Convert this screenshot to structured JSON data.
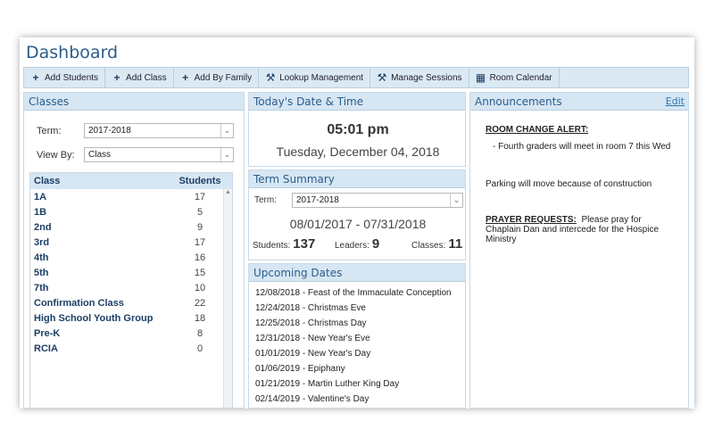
{
  "title": "Dashboard",
  "toolbar": [
    {
      "icon": "plus-icon",
      "glyph": "+",
      "label": "Add Students"
    },
    {
      "icon": "plus-icon",
      "glyph": "+",
      "label": "Add Class"
    },
    {
      "icon": "plus-icon",
      "glyph": "+",
      "label": "Add By Family"
    },
    {
      "icon": "wrench-icon",
      "glyph": "⚒",
      "label": "Lookup Management"
    },
    {
      "icon": "wrench-icon",
      "glyph": "⚒",
      "label": "Manage Sessions"
    },
    {
      "icon": "calendar-icon",
      "glyph": "▦",
      "label": "Room Calendar"
    }
  ],
  "classes": {
    "header": "Classes",
    "term_label": "Term:",
    "term_value": "2017-2018",
    "viewby_label": "View By:",
    "viewby_value": "Class",
    "col_class": "Class",
    "col_students": "Students",
    "rows": [
      {
        "name": "1A",
        "count": "17"
      },
      {
        "name": "1B",
        "count": "5"
      },
      {
        "name": "2nd",
        "count": "9"
      },
      {
        "name": "3rd",
        "count": "17"
      },
      {
        "name": "4th",
        "count": "16"
      },
      {
        "name": "5th",
        "count": "15"
      },
      {
        "name": "7th",
        "count": "10"
      },
      {
        "name": "Confirmation Class",
        "count": "22"
      },
      {
        "name": "High School Youth Group",
        "count": "18"
      },
      {
        "name": "Pre-K",
        "count": "8"
      },
      {
        "name": "RCIA",
        "count": "0"
      }
    ]
  },
  "datetime": {
    "header": "Today's Date & Time",
    "time": "05:01 pm",
    "date": "Tuesday, December 04, 2018"
  },
  "term_summary": {
    "header": "Term Summary",
    "term_label": "Term:",
    "term_value": "2017-2018",
    "range": "08/01/2017 - 07/31/2018",
    "students_label": "Students:",
    "students": "137",
    "leaders_label": "Leaders:",
    "leaders": "9",
    "classes_label": "Classes:",
    "classes": "11"
  },
  "upcoming": {
    "header": "Upcoming Dates",
    "items": [
      "12/08/2018 - Feast of the Immaculate Conception",
      "12/24/2018 - Christmas Eve",
      "12/25/2018 - Christmas Day",
      "12/31/2018 - New Year's Eve",
      "01/01/2019 - New Year's Day",
      "01/06/2019 - Epiphany",
      "01/21/2019 - Martin Luther King Day",
      "02/14/2019 - Valentine's Day"
    ]
  },
  "announcements": {
    "header": "Announcements",
    "edit": "Edit",
    "alert_title": "ROOM CHANGE ALERT:",
    "alert_body": "- Fourth graders will meet in room 7 this Wed",
    "parking": "Parking will move because of construction",
    "prayer_title": "PRAYER REQUESTS:",
    "prayer_body": "Please pray for Chaplain Dan and intercede for the Hospice Ministry"
  },
  "colors": {
    "accent": "#2c5d8a",
    "header_bg": "#d6e6f3",
    "link": "#2c7ab0"
  }
}
